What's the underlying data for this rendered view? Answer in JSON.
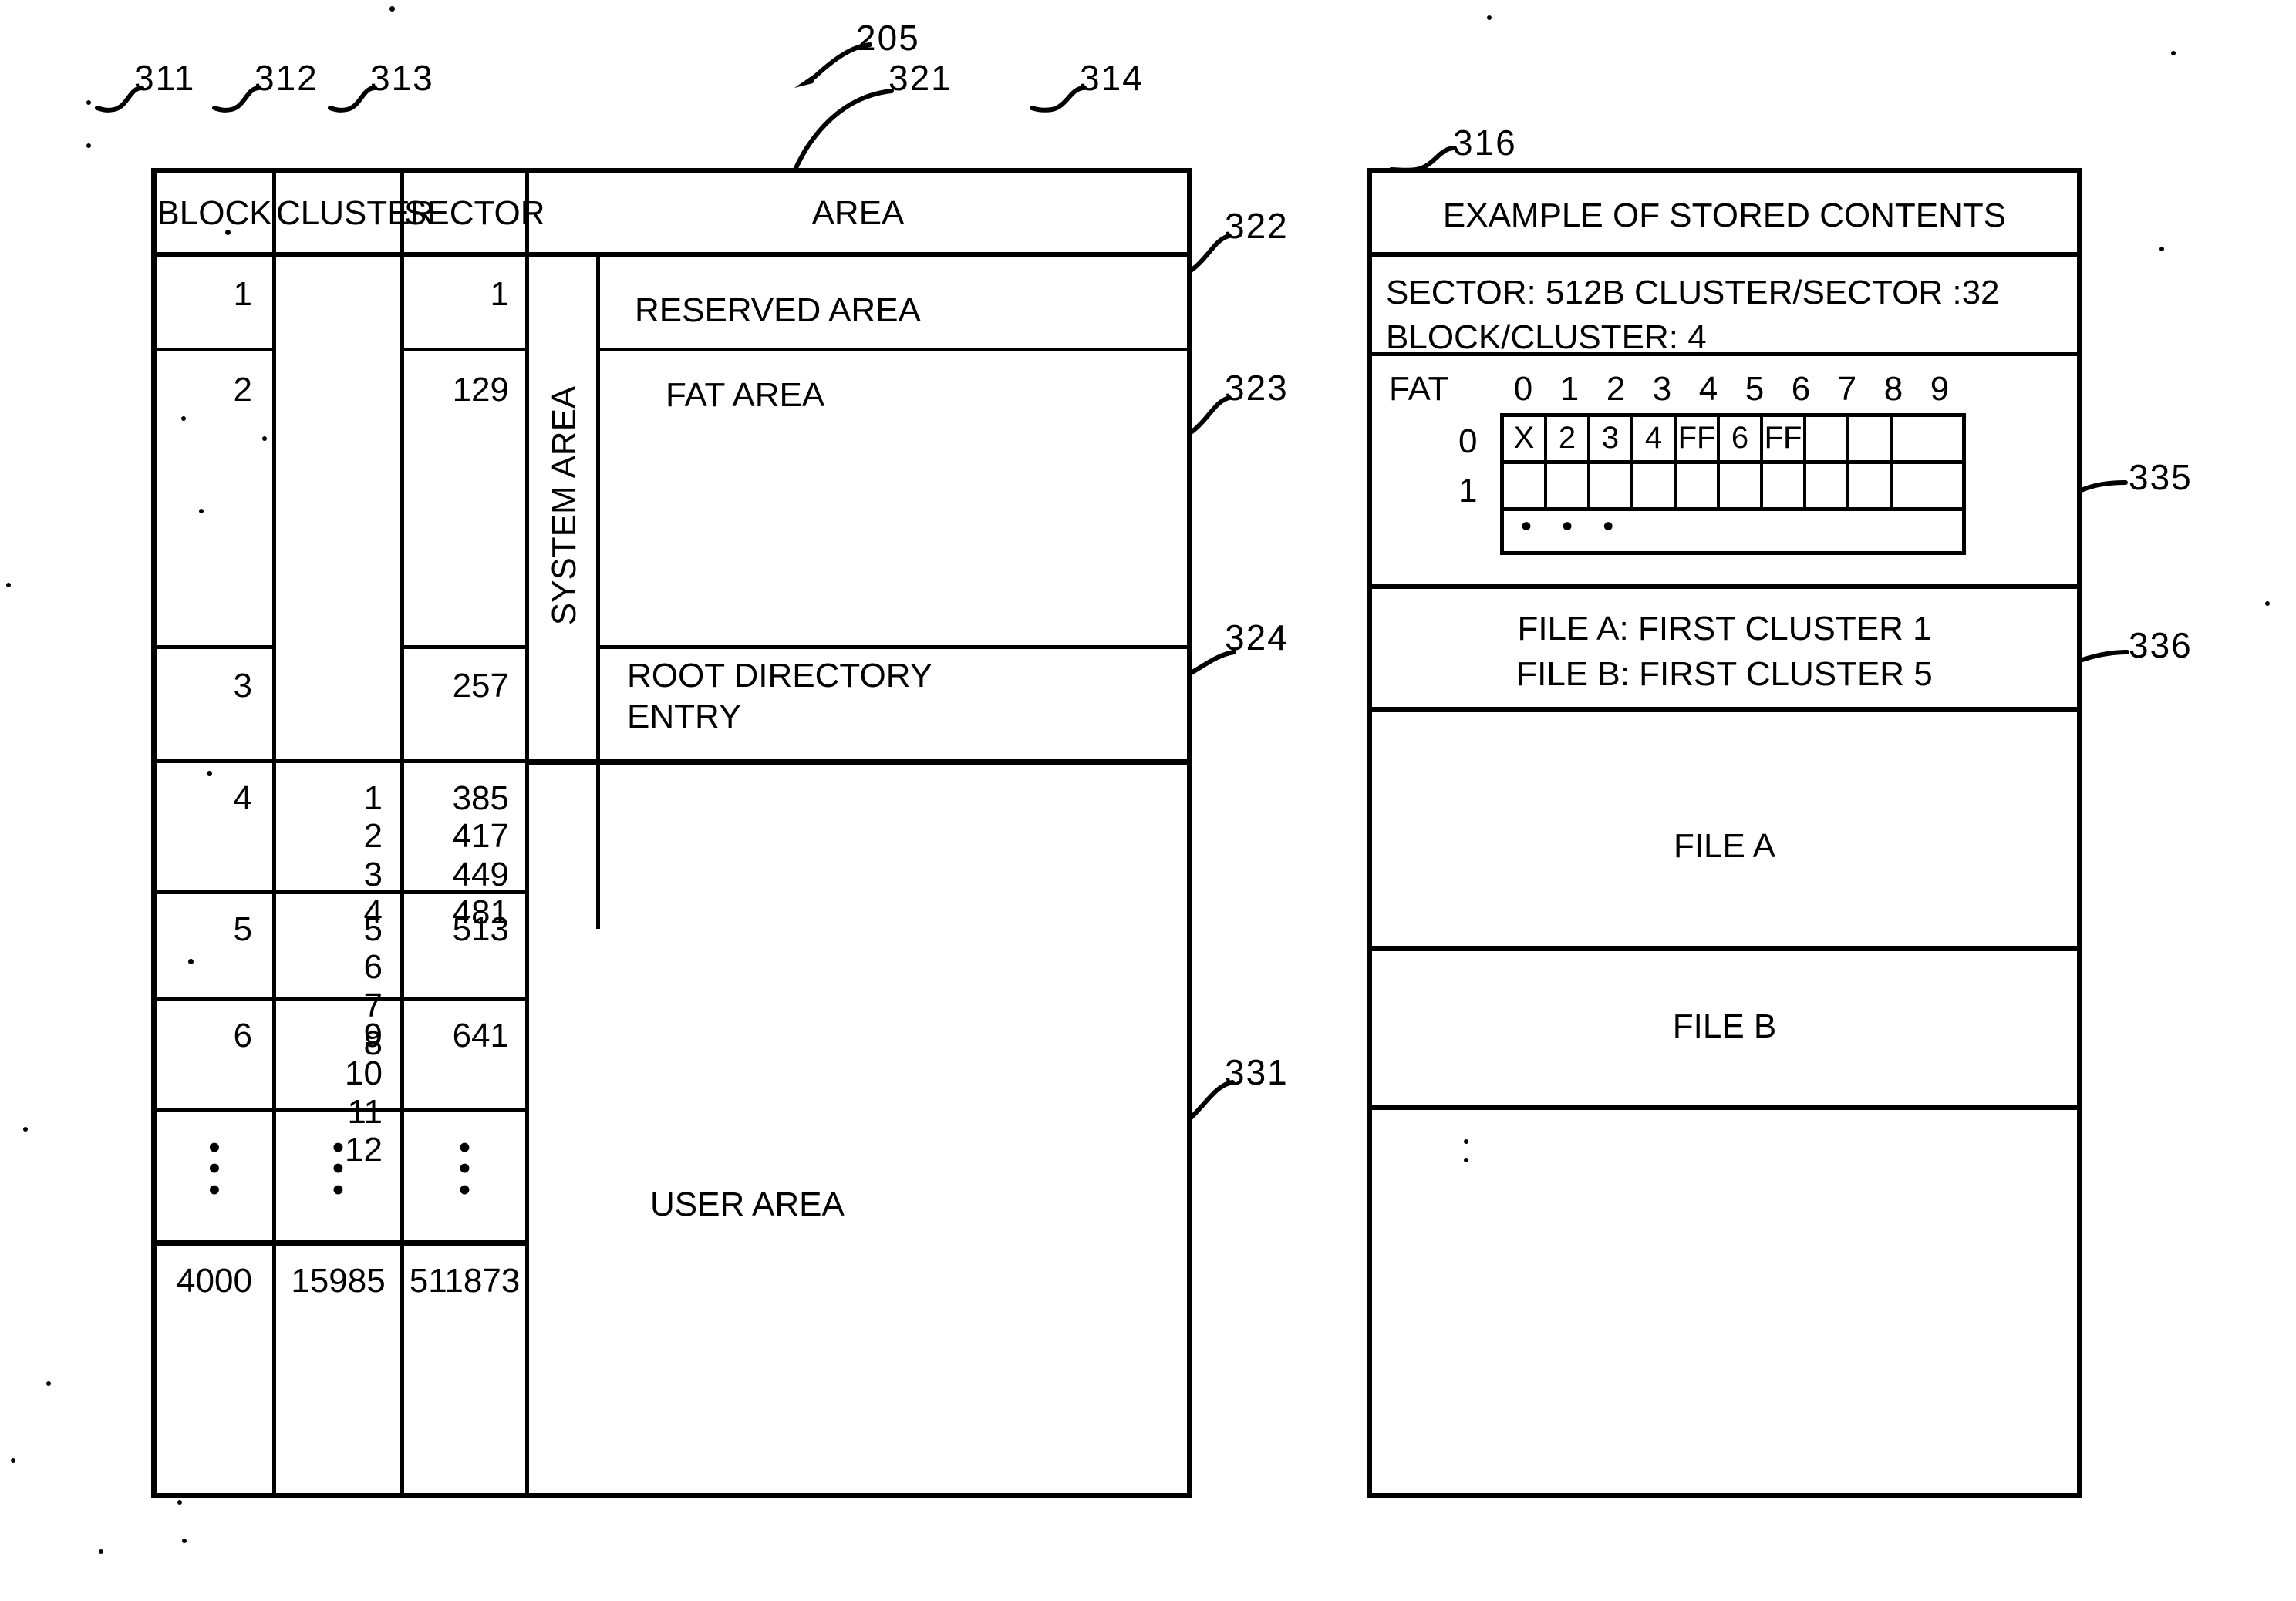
{
  "figure": {
    "reference_numerals": {
      "main": "205",
      "block_column": "311",
      "cluster_column": "312",
      "sector_column": "313",
      "area_column": "314",
      "system_area": "321",
      "reserved_area": "322",
      "fat_area": "323",
      "root_directory_entry": "324",
      "user_area": "331",
      "fat_table": "335",
      "root_dir_contents": "336",
      "stored_contents_panel": "316"
    }
  },
  "memory_map": {
    "headers": {
      "block": "BLOCK",
      "cluster": "CLUSTER",
      "sector": "SECTOR",
      "area": "AREA"
    },
    "system_area_label": "SYSTEM AREA",
    "rows": [
      {
        "block": "1",
        "cluster": "",
        "sector": "1",
        "area": "RESERVED AREA"
      },
      {
        "block": "2",
        "cluster": "",
        "sector": "129",
        "area": "FAT AREA"
      },
      {
        "block": "3",
        "cluster": "",
        "sector": "257",
        "area": "ROOT DIRECTORY\nENTRY"
      },
      {
        "block": "4",
        "cluster": "1\n2\n3\n4",
        "sector": "385\n417\n449\n481",
        "area": ""
      },
      {
        "block": "5",
        "cluster": "5\n6\n7\n8",
        "sector": "513",
        "area": "USER AREA"
      },
      {
        "block": "6",
        "cluster": "9\n10\n11\n12",
        "sector": "641",
        "area": ""
      },
      {
        "block": "⋮",
        "cluster": "⋮",
        "sector": "⋮",
        "area": ""
      },
      {
        "block": "4000",
        "cluster": "15985",
        "sector": "511873",
        "area": ""
      }
    ],
    "user_area_label": "USER AREA"
  },
  "stored_contents": {
    "title": "EXAMPLE OF STORED CONTENTS",
    "parameters": "SECTOR: 512B  CLUSTER/SECTOR :32\nBLOCK/CLUSTER: 4",
    "fat": {
      "label": "FAT",
      "column_headers": [
        "0",
        "1",
        "2",
        "3",
        "4",
        "5",
        "6",
        "7",
        "8",
        "9"
      ],
      "row_labels": [
        "0",
        "1"
      ],
      "rows": [
        [
          "X",
          "2",
          "3",
          "4",
          "FF",
          "6",
          "FF",
          "",
          "",
          ""
        ],
        [
          "",
          "",
          "",
          "",
          "",
          "",
          "",
          "",
          "",
          ""
        ]
      ],
      "ellipsis": "• • •"
    },
    "root_directory": "FILE A: FIRST CLUSTER 1\nFILE B: FIRST CLUSTER 5",
    "file_a": "FILE A",
    "file_b": "FILE B"
  }
}
